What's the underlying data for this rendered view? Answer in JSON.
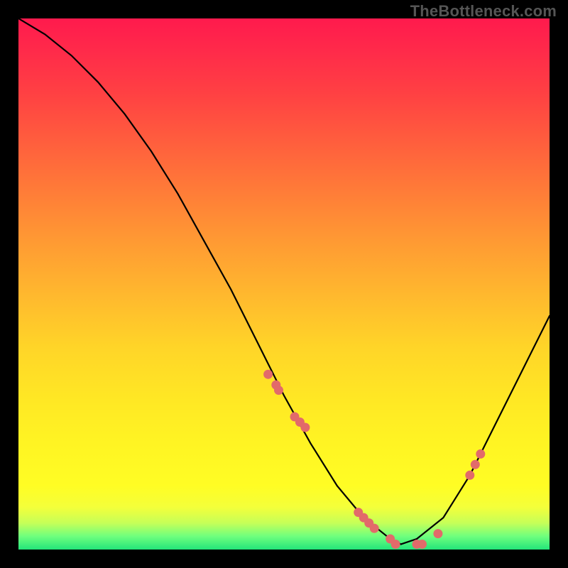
{
  "watermark": {
    "text": "TheBottleneck.com"
  },
  "chart_data": {
    "type": "line",
    "title": "",
    "xlabel": "",
    "ylabel": "",
    "xlim": [
      0,
      100
    ],
    "ylim": [
      0,
      100
    ],
    "series": [
      {
        "name": "bottleneck-curve",
        "x": [
          0,
          5,
          10,
          15,
          20,
          25,
          30,
          35,
          40,
          45,
          50,
          55,
          60,
          65,
          70,
          72,
          75,
          80,
          85,
          90,
          95,
          100
        ],
        "values": [
          100,
          97,
          93,
          88,
          82,
          75,
          67,
          58,
          49,
          39,
          29,
          20,
          12,
          6,
          2,
          1,
          2,
          6,
          14,
          24,
          34,
          44
        ]
      }
    ],
    "points": {
      "name": "highlighted-dots",
      "x": [
        47,
        48.5,
        49,
        52,
        53,
        54,
        64,
        65,
        66,
        67,
        70,
        71,
        75,
        76,
        79,
        85,
        86,
        87
      ],
      "values": [
        33,
        31,
        30,
        25,
        24,
        23,
        7,
        6,
        5,
        4,
        2,
        1,
        1,
        1,
        3,
        14,
        16,
        18
      ]
    },
    "background_gradient": {
      "top": "#ff1a4d",
      "mid": "#ffe824",
      "bottom": "#23e57a"
    }
  }
}
